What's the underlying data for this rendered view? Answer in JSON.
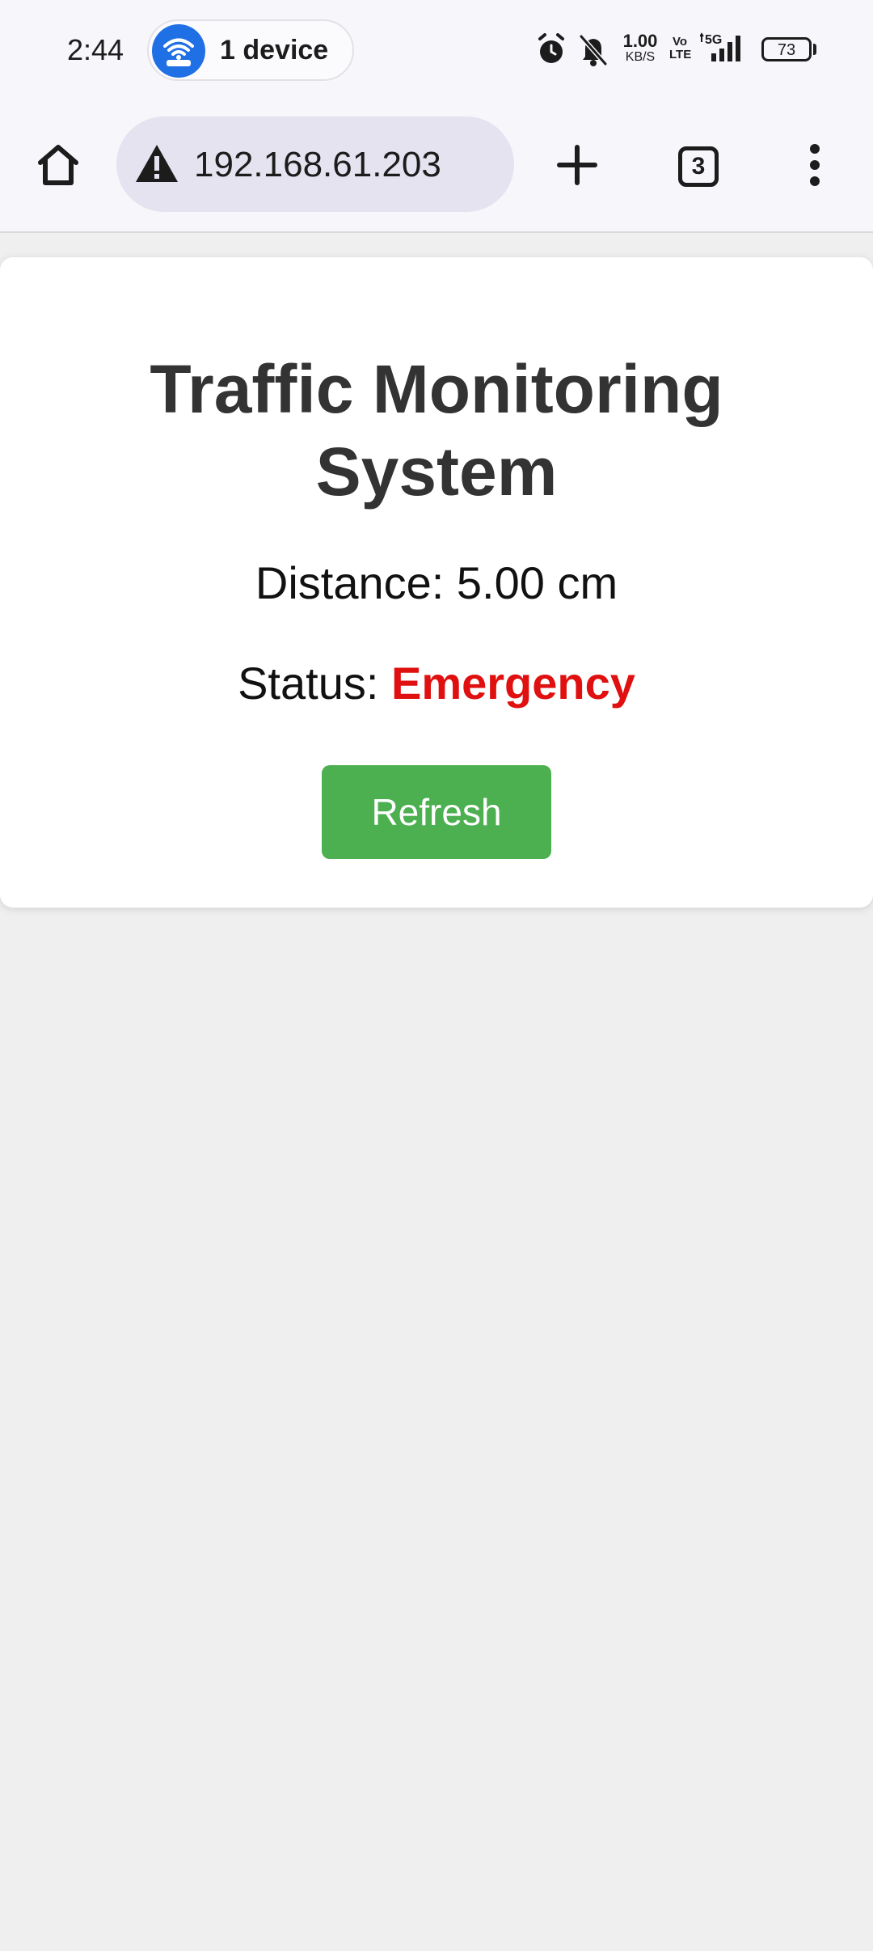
{
  "status_bar": {
    "time": "2:44",
    "hotspot_label": "1 device",
    "net_speed_value": "1.00",
    "net_speed_unit": "KB/S",
    "volte_top": "Vo",
    "volte_bottom": "LTE",
    "network_type": "5G",
    "battery_level": "73",
    "icons": [
      "hotspot-icon",
      "alarm-icon",
      "bell-muted-icon",
      "signal-icon",
      "battery-icon"
    ]
  },
  "browser": {
    "url": "192.168.61.203",
    "security_icon": "warning-icon",
    "tab_count": "3",
    "icons": [
      "home-icon",
      "warning-icon",
      "new-tab-plus-icon",
      "tab-switcher-icon",
      "more-menu-icon"
    ]
  },
  "page": {
    "title_line1": "Traffic Monitoring",
    "title_line2": "System",
    "distance_label": "Distance:",
    "distance_value": "5.00 cm",
    "status_label": "Status:",
    "status_value": "Emergency",
    "refresh_label": "Refresh"
  },
  "colors": {
    "status_emergency": "#e01010",
    "refresh_button": "#4caf50",
    "hotspot_icon_bg": "#1f6fe5",
    "page_background": "#efefef",
    "card_background": "#ffffff",
    "title_text": "#333333"
  }
}
